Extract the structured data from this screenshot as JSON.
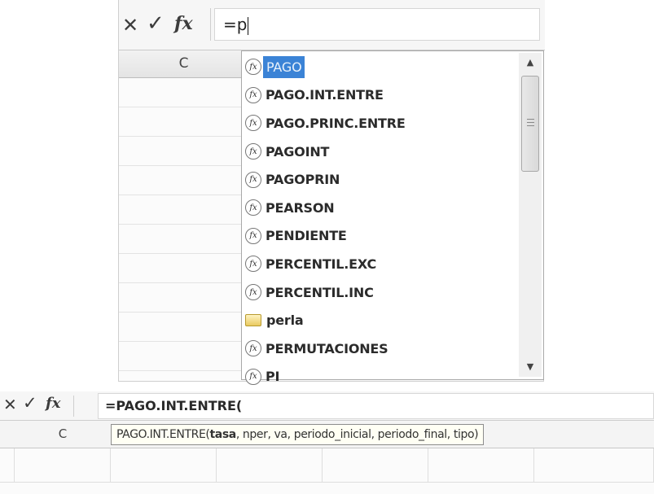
{
  "top": {
    "formula_bar": {
      "cancel_icon": "cancel-x-icon",
      "enter_icon": "checkmark-icon",
      "function_icon": "insert-function-fx-icon",
      "cancel_glyph": "✕",
      "enter_glyph": "✓",
      "function_glyph": "fx",
      "formula_value": "=p"
    },
    "column_header": "C",
    "autocomplete": {
      "selected_index": 0,
      "items": [
        {
          "label": "PAGO",
          "icon": "function-icon"
        },
        {
          "label": "PAGO.INT.ENTRE",
          "icon": "function-icon"
        },
        {
          "label": "PAGO.PRINC.ENTRE",
          "icon": "function-icon"
        },
        {
          "label": "PAGOINT",
          "icon": "function-icon"
        },
        {
          "label": "PAGOPRIN",
          "icon": "function-icon"
        },
        {
          "label": "PEARSON",
          "icon": "function-icon"
        },
        {
          "label": "PENDIENTE",
          "icon": "function-icon"
        },
        {
          "label": "PERCENTIL.EXC",
          "icon": "function-icon"
        },
        {
          "label": "PERCENTIL.INC",
          "icon": "function-icon"
        },
        {
          "label": "perla",
          "icon": "defined-name-icon"
        },
        {
          "label": "PERMUTACIONES",
          "icon": "function-icon"
        },
        {
          "label": "PI",
          "icon": "function-icon"
        }
      ],
      "fx_glyph": "fx",
      "scroll_up_glyph": "▲",
      "scroll_down_glyph": "▼"
    }
  },
  "bottom": {
    "formula_bar": {
      "cancel_glyph": "✕",
      "enter_glyph": "✓",
      "function_glyph": "fx",
      "formula_value": "=PAGO.INT.ENTRE("
    },
    "column_header": "C",
    "tooltip": {
      "function_name": "PAGO.INT.ENTRE(",
      "current_arg": "tasa",
      "remaining_args": ", nper, va, periodo_inicial, periodo_final, tipo)"
    }
  },
  "colors": {
    "selection": "#3b83d6",
    "tooltip_bg": "#fffff4",
    "header_bg": "#f2f2f2"
  }
}
